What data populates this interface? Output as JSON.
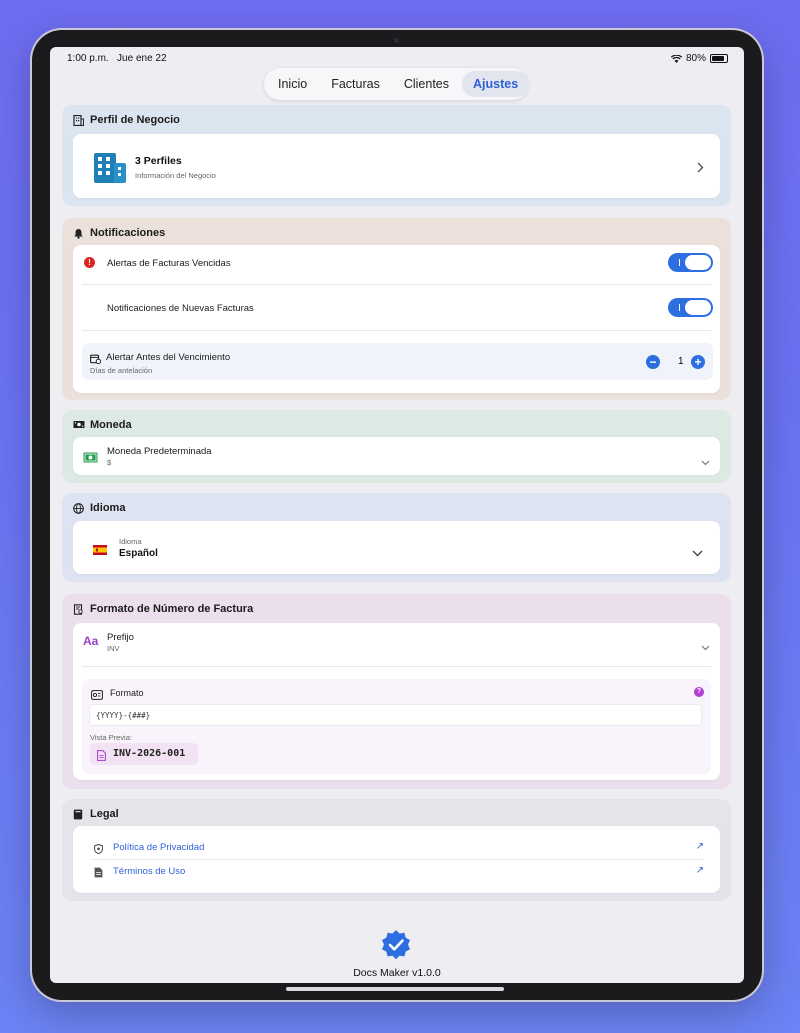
{
  "status_bar": {
    "time": "1:00 p.m.",
    "date": "Jue ene 22",
    "battery": "80%"
  },
  "tabs": [
    {
      "label": "Inicio"
    },
    {
      "label": "Facturas"
    },
    {
      "label": "Clientes"
    },
    {
      "label": "Ajustes",
      "active": true
    }
  ],
  "profile": {
    "header": "Perfil de Negocio",
    "title": "3 Perfiles",
    "subtitle": "Información del Negocio"
  },
  "notifications": {
    "header": "Notificaciones",
    "overdue_label": "Alertas de Facturas Vencidas",
    "overdue_on": true,
    "new_label": "Notificaciones de Nuevas Facturas",
    "new_on": true,
    "alert_label": "Alertar Antes del Vencimiento",
    "alert_sub": "Días de antelación",
    "alert_value": "1"
  },
  "currency": {
    "header": "Moneda",
    "label": "Moneda Predeterminada",
    "value": "$"
  },
  "language": {
    "header": "Idioma",
    "label": "Idioma",
    "value": "Español"
  },
  "invoice_format": {
    "header": "Formato de Número de Factura",
    "prefix_label": "Prefijo",
    "prefix_value": "INV",
    "format_label": "Formato",
    "format_value": "{YYYY}-{###}",
    "preview_label": "Vista Previa:",
    "preview_value": "INV-2026-001"
  },
  "legal": {
    "header": "Legal",
    "privacy": "Política de Privacidad",
    "terms": "Términos de Uso"
  },
  "footer": {
    "version": "Docs Maker v1.0.0"
  },
  "colors": {
    "accent": "#2d6fe0",
    "alert": "#e02424",
    "background": "#6e6cf0"
  }
}
